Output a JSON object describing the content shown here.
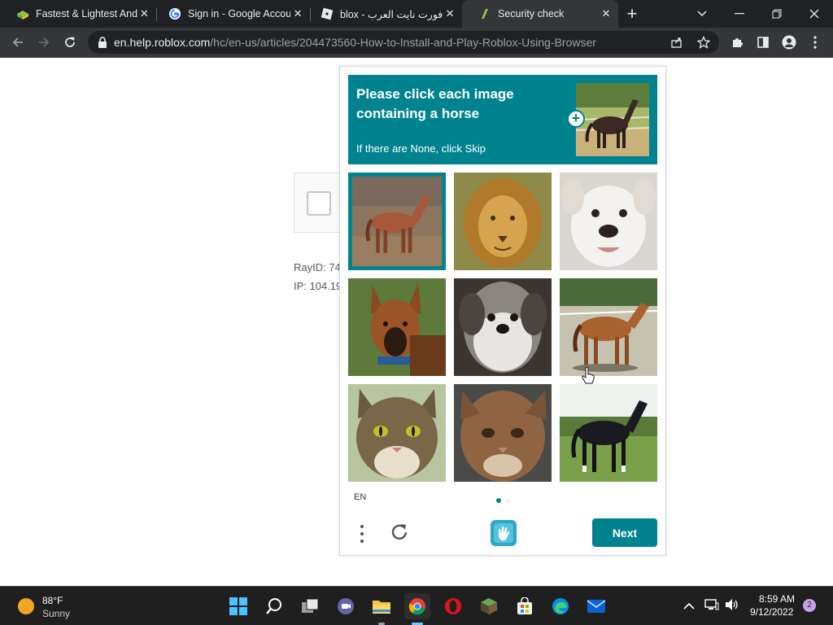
{
  "browser": {
    "tabs": [
      {
        "title": "Fastest & Lightest Andr",
        "icon": "bluestacks-icon",
        "active": false
      },
      {
        "title": "Sign in - Google Accou",
        "icon": "google-icon",
        "active": false
      },
      {
        "title": "blox - فورت نايت العرب",
        "icon": "roblox-icon",
        "active": false
      },
      {
        "title": "Security check",
        "icon": "security-check-icon",
        "active": true
      }
    ],
    "new_tab_label": "+",
    "address": {
      "host": "en.help.roblox.com",
      "path": "/hc/en-us/articles/204473560-How-to-Install-and-Play-Roblox-Using-Browser"
    }
  },
  "page": {
    "ray_id": "RayID: 74",
    "ip": "IP: 104.19"
  },
  "captcha": {
    "prompt_title": "Please click each image containing a horse",
    "prompt_subtitle": "If there are None, click Skip",
    "grid": [
      {
        "label": "horse",
        "selected": true
      },
      {
        "label": "lion",
        "selected": false
      },
      {
        "label": "dog",
        "selected": false
      },
      {
        "label": "dog",
        "selected": false
      },
      {
        "label": "dog",
        "selected": false
      },
      {
        "label": "horse",
        "selected": false
      },
      {
        "label": "cat",
        "selected": false
      },
      {
        "label": "cat",
        "selected": false
      },
      {
        "label": "horse",
        "selected": false
      }
    ],
    "language": "EN",
    "page_index": 1,
    "page_count": 2,
    "next_label": "Next",
    "accent_color": "#00838f"
  },
  "taskbar": {
    "weather": {
      "temp": "88°F",
      "condition": "Sunny"
    },
    "clock": {
      "time": "8:59 AM",
      "date": "9/12/2022"
    },
    "notification_count": "2",
    "apps": [
      "start-icon",
      "search-icon",
      "task-view-icon",
      "teams-chat-icon",
      "file-explorer-icon",
      "chrome-icon",
      "opera-icon",
      "minecraft-icon",
      "store-icon",
      "edge-icon",
      "mail-icon"
    ]
  }
}
